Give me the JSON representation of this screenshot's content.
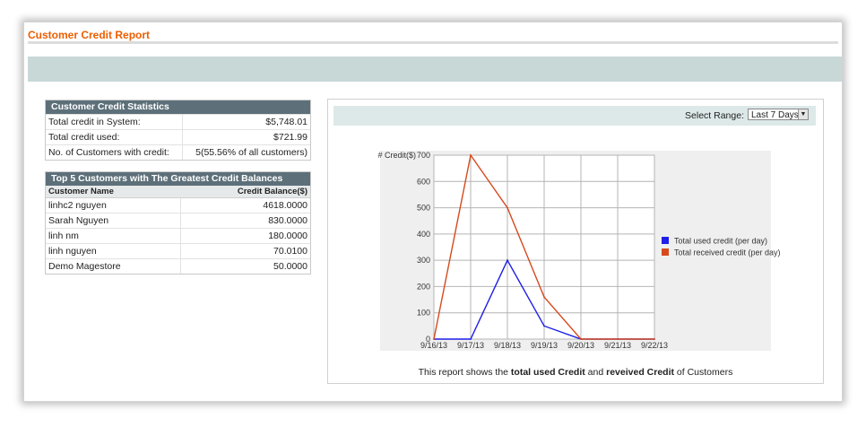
{
  "page": {
    "title": "Customer Credit Report"
  },
  "stats": {
    "header": "Customer Credit Statistics",
    "rows": [
      {
        "label": "Total credit in System:",
        "value": "$5,748.01"
      },
      {
        "label": "Total credit used:",
        "value": "$721.99"
      },
      {
        "label": "No. of Customers with credit:",
        "value": "5(55.56% of all customers)"
      }
    ]
  },
  "top_customers": {
    "header": "Top 5 Customers with The Greatest Credit Balances",
    "col_name": "Customer Name",
    "col_balance": "Credit Balance($)",
    "rows": [
      {
        "name": "linhc2 nguyen",
        "balance": "4618.0000"
      },
      {
        "name": "Sarah Nguyen",
        "balance": "830.0000"
      },
      {
        "name": "linh nm",
        "balance": "180.0000"
      },
      {
        "name": "linh nguyen",
        "balance": "70.0100"
      },
      {
        "name": "Demo Magestore",
        "balance": "50.0000"
      }
    ]
  },
  "chart_toolbar": {
    "range_label": "Select Range:",
    "range_value": "Last 7 Days"
  },
  "caption": {
    "t1": "This report shows the ",
    "b1": "total used Credit",
    "t2": " and ",
    "b2": "reveived Credit",
    "t3": " of Customers"
  },
  "colors": {
    "used": "#1f1fe8",
    "received": "#d64a1e"
  },
  "chart_data": {
    "type": "line",
    "ylabel": "# Credit($)",
    "ylim": [
      0,
      700
    ],
    "yticks": [
      0,
      100,
      200,
      300,
      400,
      500,
      600,
      700
    ],
    "categories": [
      "9/16/13",
      "9/17/13",
      "9/18/13",
      "9/19/13",
      "9/20/13",
      "9/21/13",
      "9/22/13"
    ],
    "series": [
      {
        "name": "Total used credit (per day)",
        "values": [
          0,
          0,
          300,
          50,
          0,
          0,
          0
        ]
      },
      {
        "name": "Total received credit (per day)",
        "values": [
          0,
          700,
          500,
          160,
          0,
          0,
          0
        ]
      }
    ],
    "grid": true,
    "legend": "right"
  }
}
